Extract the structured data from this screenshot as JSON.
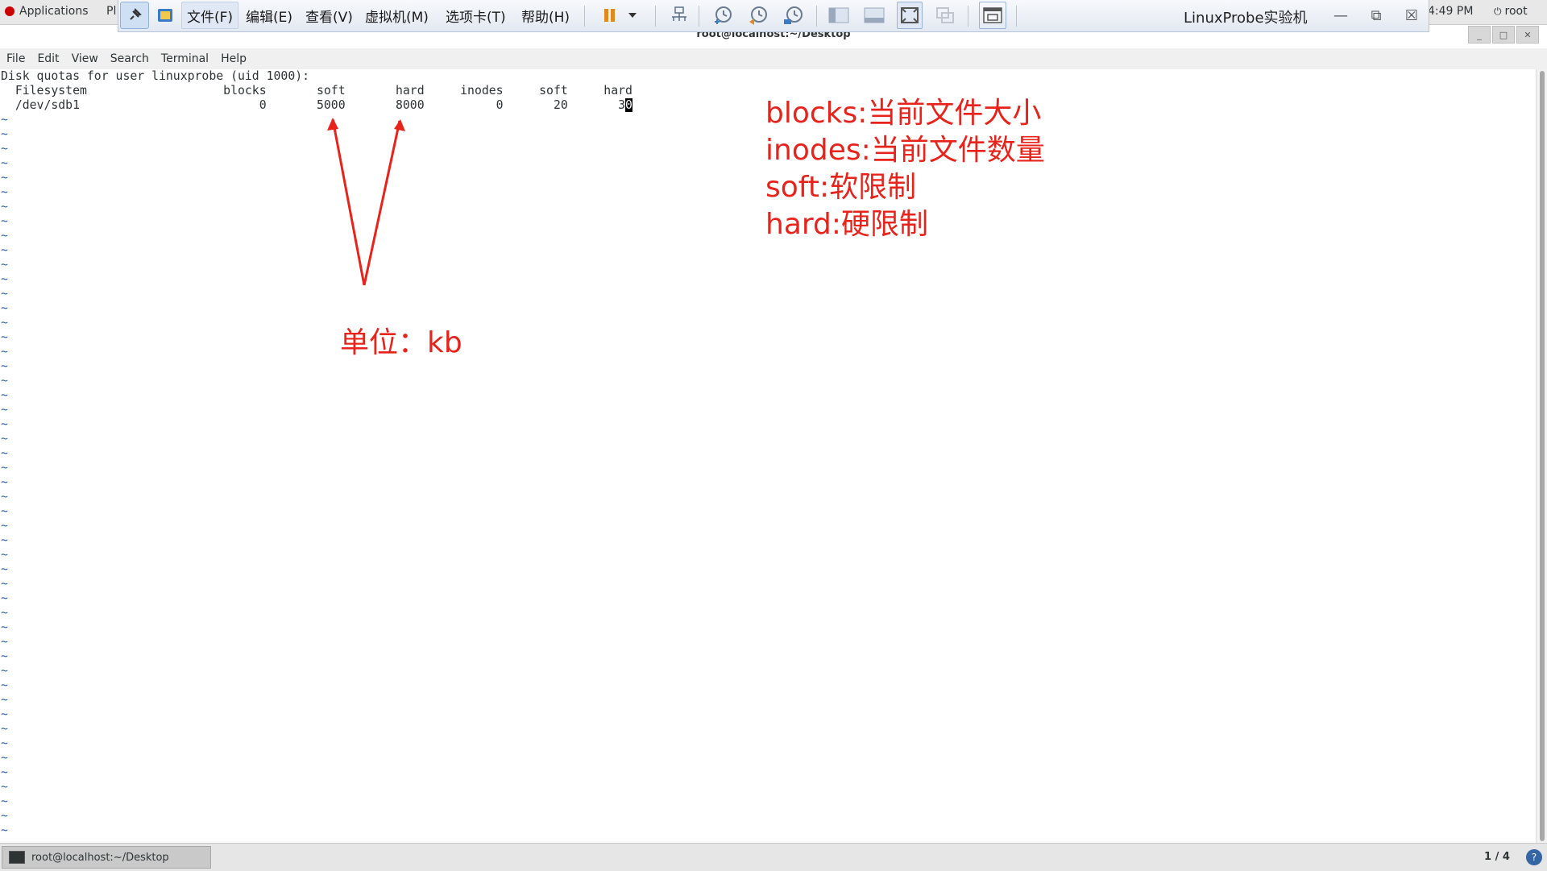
{
  "gnome_bar": {
    "applications": "Applications",
    "places_fragment": "Pl",
    "clock": "4:49 PM",
    "user": "root"
  },
  "vmware_toolbar": {
    "menus": [
      "文件(F)",
      "编辑(E)",
      "查看(V)",
      "虚拟机(M)",
      "选项卡(T)",
      "帮助(H)"
    ],
    "vm_title": "LinuxProbe实验机"
  },
  "terminal": {
    "window_title": "root@localhost:~/Desktop",
    "menubar": [
      "File",
      "Edit",
      "View",
      "Search",
      "Terminal",
      "Help"
    ],
    "header_line": "Disk quotas for user linuxprobe (uid 1000):",
    "columns_line": "  Filesystem                   blocks       soft       hard     inodes     soft     hard",
    "row_prefix": "  /dev/sdb1                         0       5000       8000          0       20       3",
    "row_cursor_char": "0",
    "tilde_count": 50
  },
  "annotations": {
    "legend": [
      "blocks:当前文件大小",
      "inodes:当前文件数量",
      "soft:软限制",
      "hard:硬限制"
    ],
    "unit": "单位：kb",
    "color": "#e8231b"
  },
  "taskbar": {
    "task_label": "root@localhost:~/Desktop",
    "workspace": "1 / 4",
    "help_glyph": "?"
  }
}
